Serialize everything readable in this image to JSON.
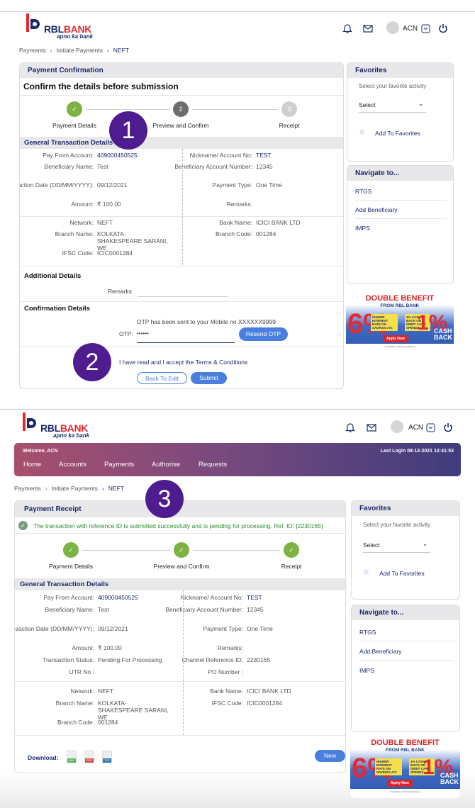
{
  "brand": {
    "name_a": "RBL",
    "name_b": "BANK",
    "tagline": "apno ka bank",
    "color": "#1c2a6b",
    "accent": "#e42a2e"
  },
  "header": {
    "user": "ACN",
    "icons": [
      "bell-icon",
      "mail-icon",
      "avatar",
      "chevron-down-icon",
      "power-icon"
    ]
  },
  "breadcrumb": [
    "Payments",
    "Initiate Payments",
    "NEFT"
  ],
  "annotations": [
    "1",
    "2",
    "3"
  ],
  "screen1": {
    "card_title": "Payment Confirmation",
    "heading": "Confirm the details before submission",
    "steps": [
      {
        "label": "Payment Details",
        "num": "✓",
        "state": "done"
      },
      {
        "label": "Preview and Confirm",
        "num": "2",
        "state": "active"
      },
      {
        "label": "Receipt",
        "num": "3",
        "state": "pending"
      }
    ],
    "section": "General Transaction Details",
    "left": [
      [
        "Pay From Account:",
        "409000450525"
      ],
      [
        "Beneficiary Name:",
        "Test"
      ],
      [
        "Transaction Date (DD/MM/YYYY):",
        "09/12/2021"
      ],
      [
        "Amount:",
        "₹ 100.00"
      ]
    ],
    "right": [
      [
        "Nickname/ Account No:",
        "TEST"
      ],
      [
        "Beneficiary Account Number:",
        "12345"
      ],
      [
        "Payment Type:",
        "One Time"
      ],
      [
        "Remarks:",
        ""
      ]
    ],
    "left2": [
      [
        "Network:",
        "NEFT"
      ],
      [
        "Branch Name:",
        "KOLKATA-SHAKESPEARE SARANI, WE"
      ],
      [
        "IFSC Code:",
        "ICIC0001284"
      ]
    ],
    "right2": [
      [
        "Bank Name:",
        "ICICI BANK LTD"
      ],
      [
        "Branch Code:",
        "001284"
      ]
    ],
    "additional": "Additional Details",
    "remarks_label": "Remarks",
    "confirmation": "Confirmation Details",
    "otp_msg": "OTP has been sent to your Mobile no XXXXXX9999",
    "otp_label": "OTP:",
    "otp_value": "••••••",
    "resend": "Resend OTP",
    "terms": "I have read and I accept the Terms & Conditions",
    "back": "Back To Edit",
    "submit": "Submit"
  },
  "screen2": {
    "welcome": "Welcome, ACN",
    "last_login": "Last Login 08-12-2021 12:41:53",
    "nav": [
      "Home",
      "Accounts",
      "Payments",
      "Authorise",
      "Requests"
    ],
    "card_title": "Payment Receipt",
    "success": "The transaction with reference ID is submitted successfully and is pending for processing. Ref. ID: [2230165]",
    "steps": [
      {
        "label": "Payment Details",
        "num": "✓",
        "state": "done"
      },
      {
        "label": "Preview and Confirm",
        "num": "✓",
        "state": "done"
      },
      {
        "label": "Receipt",
        "num": "✓",
        "state": "done"
      }
    ],
    "section": "General Transaction Details",
    "left": [
      [
        "Pay From Account:",
        "409000450525"
      ],
      [
        "Beneficiary Name:",
        "Test"
      ],
      [
        "Transaction Date (DD/MM/YYYY):",
        "09/12/2021"
      ],
      [
        "Amount:",
        "₹ 100.00"
      ],
      [
        "Transaction Status:",
        "Pending For Processing"
      ],
      [
        "UTR No :",
        ""
      ]
    ],
    "right": [
      [
        "Nickname/ Account No:",
        "TEST"
      ],
      [
        "Beneficiary Account Number:",
        "12345"
      ],
      [
        "Payment Type:",
        "One Time"
      ],
      [
        "Remarks:",
        ""
      ],
      [
        "Channel Reference ID:",
        "2230165"
      ],
      [
        "PO Number :",
        ""
      ]
    ],
    "left2": [
      [
        "Network:",
        "NEFT"
      ],
      [
        "Branch Name:",
        "KOLKATA-SHAKESPEARE SARANI, WE"
      ],
      [
        "Branch Code:",
        "001284"
      ]
    ],
    "right2": [
      [
        "Bank Name:",
        "ICICI BANK LTD"
      ],
      [
        "IFSC Code:",
        "ICIC0001284"
      ]
    ],
    "download": "Download:",
    "files": [
      {
        "label": "XLS",
        "color": "#5cb85c"
      },
      {
        "label": "PDF",
        "color": "#d9534f"
      },
      {
        "label": "TXT",
        "color": "#337ab7"
      }
    ],
    "new": "New"
  },
  "favorites": {
    "title": "Favorites",
    "hint": "Select your favorite activity",
    "select": "Select",
    "add": "Add To Favorites"
  },
  "navigate": {
    "title": "Navigate to...",
    "items": [
      "RTGS",
      "Add Beneficiary",
      "IMPS"
    ]
  },
  "banner": {
    "title": "DOUBLE BENEFIT",
    "sub": "FROM RBL BANK",
    "pct1": "6%",
    "box1": "HIGHER INTEREST RATE ON SAVINGS A/C",
    "box2": "1% CASH BACK ON DEBIT CARD SPENDS",
    "apply": "Apply Now",
    "pct2": "1%",
    "cash": "CASH BACK"
  },
  "colors": {
    "step_done": "#7cb342",
    "step_active": "#6d6d6d",
    "step_pending": "#cfcfcf",
    "primary_btn": "#4a7fe0",
    "badge": "#4f1c8f",
    "success": "#2e8b2e"
  }
}
